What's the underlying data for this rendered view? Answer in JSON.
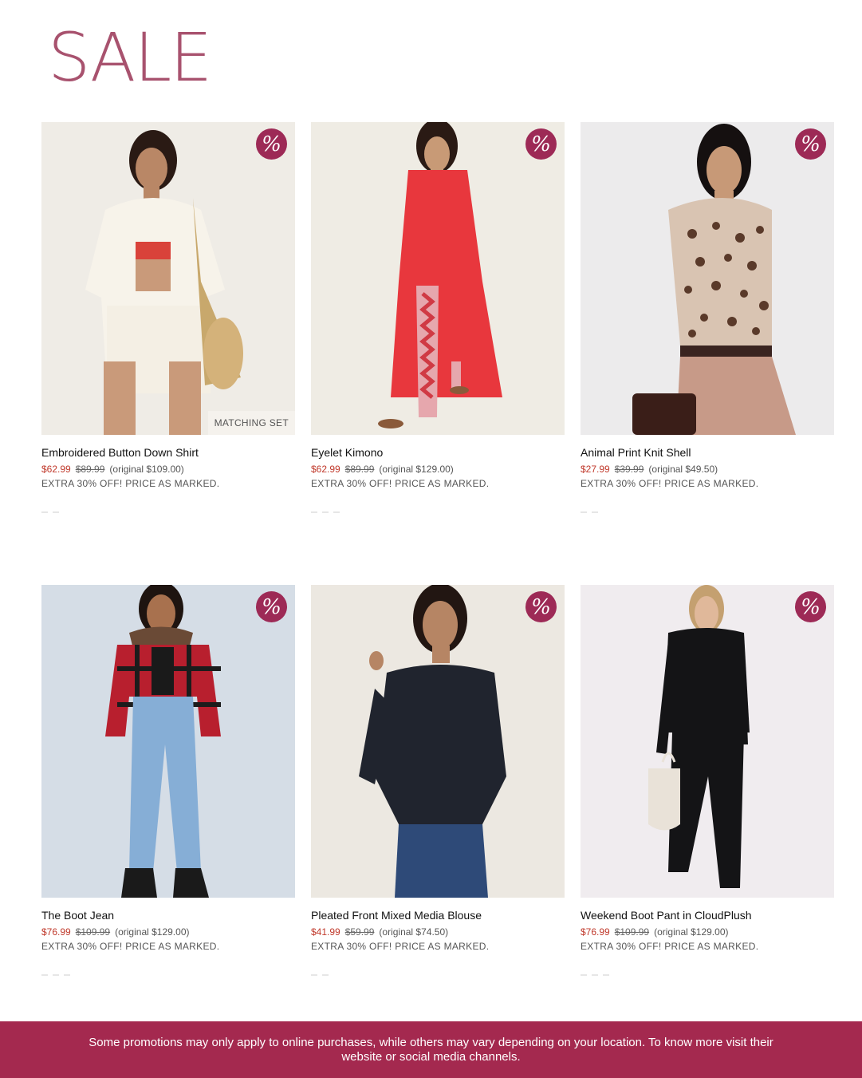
{
  "page": {
    "title": "SALE"
  },
  "products": [
    {
      "name": "Embroidered Button Down Shirt",
      "sale_price": "$62.99",
      "was_price": "$89.99",
      "original": "(original $109.00)",
      "promo": "EXTRA 30% OFF! PRICE AS MARKED.",
      "badge": "%",
      "tag": "MATCHING SET"
    },
    {
      "name": "Eyelet Kimono",
      "sale_price": "$62.99",
      "was_price": "$89.99",
      "original": "(original $129.00)",
      "promo": "EXTRA 30% OFF! PRICE AS MARKED.",
      "badge": "%"
    },
    {
      "name": "Animal Print Knit Shell",
      "sale_price": "$27.99",
      "was_price": "$39.99",
      "original": "(original $49.50)",
      "promo": "EXTRA 30% OFF! PRICE AS MARKED.",
      "badge": "%"
    },
    {
      "name": "The Boot Jean",
      "sale_price": "$76.99",
      "was_price": "$109.99",
      "original": "(original $129.00)",
      "promo": "EXTRA 30% OFF! PRICE AS MARKED.",
      "badge": "%"
    },
    {
      "name": "Pleated Front Mixed Media Blouse",
      "sale_price": "$41.99",
      "was_price": "$59.99",
      "original": "(original $74.50)",
      "promo": "EXTRA 30% OFF! PRICE AS MARKED.",
      "badge": "%"
    },
    {
      "name": "Weekend Boot Pant in CloudPlush",
      "sale_price": "$76.99",
      "was_price": "$109.99",
      "original": "(original $129.00)",
      "promo": "EXTRA 30% OFF! PRICE AS MARKED.",
      "badge": "%"
    }
  ],
  "footer": {
    "text": "Some promotions may only apply to online purchases, while others may vary depending on your location. To know more visit their website or social media channels."
  },
  "colors": {
    "brand": "#a4294f",
    "title": "#a8526e",
    "sale": "#c0392b"
  }
}
